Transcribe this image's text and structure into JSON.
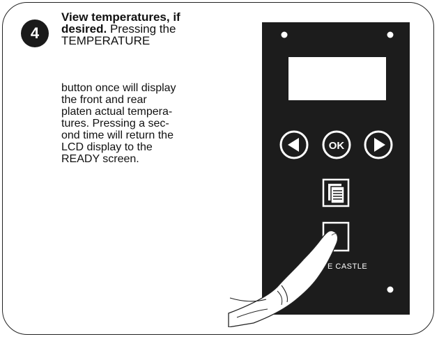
{
  "step": {
    "number": "4",
    "heading": "View temperatures, if desired.",
    "heading_line1": "View temperatures, if",
    "heading_line2": "desired.",
    "intro_rest": "Pressing the",
    "intro_line3": "TEMPERATURE",
    "body_lines": [
      "button once will display",
      "the front and rear",
      "platen actual tempera-",
      "tures. Pressing a sec-",
      "ond time will return the",
      "LCD display to the",
      "READY screen."
    ]
  },
  "panel": {
    "ok_label": "OK",
    "brand_label": "E CASTLE",
    "icons": [
      "left-arrow-icon",
      "ok-icon",
      "right-arrow-icon",
      "document-icon",
      "temperature-button-icon"
    ],
    "colors": {
      "panel": "#1c1c1c",
      "lcd": "#ffffff",
      "ink": "#ffffff"
    }
  }
}
